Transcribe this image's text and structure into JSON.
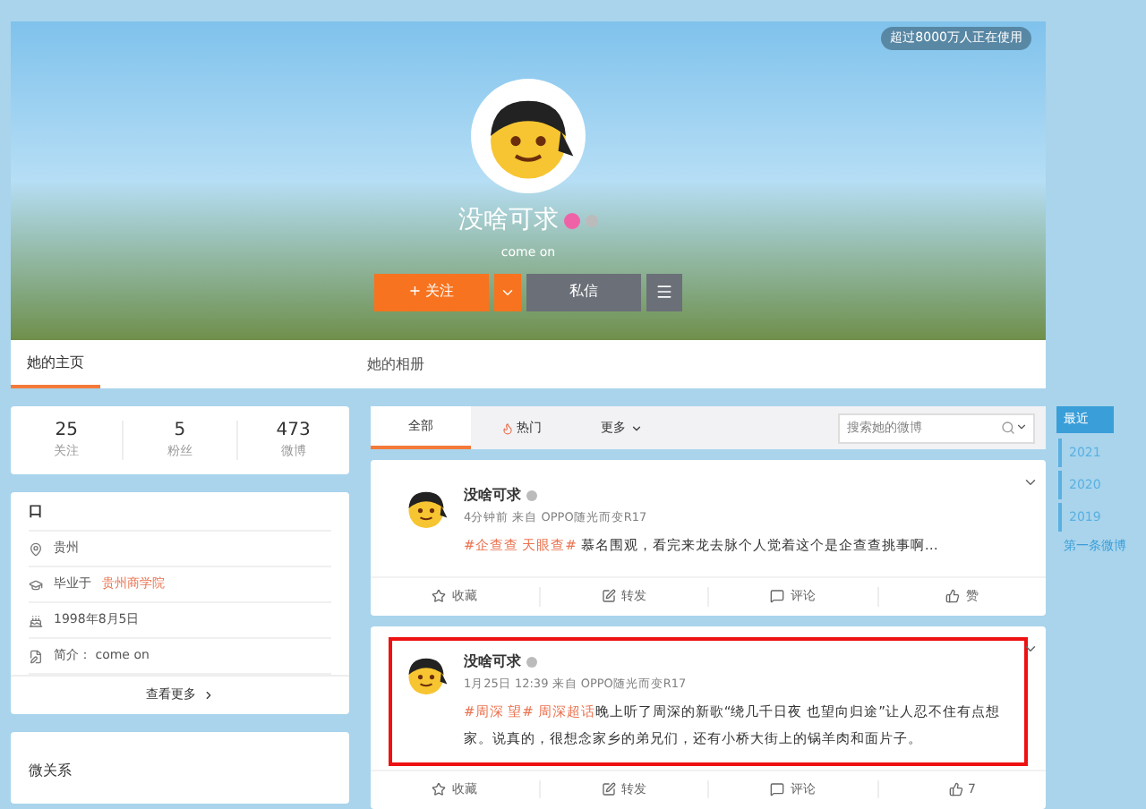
{
  "header": {
    "badge": "超过8000万人正在使用",
    "name": "没啥可求",
    "bio": "come on",
    "follow_button": "+ 关注",
    "message_button": "私信",
    "tabs": [
      {
        "label": "她的主页",
        "selected": true
      },
      {
        "label": "她的相册",
        "selected": false
      }
    ]
  },
  "stats": [
    {
      "value": "25",
      "label": "关注"
    },
    {
      "value": "5",
      "label": "粉丝"
    },
    {
      "value": "473",
      "label": "微博"
    }
  ],
  "info": {
    "title": "口",
    "rows": [
      {
        "kind": "location",
        "text": "贵州"
      },
      {
        "kind": "school",
        "prefix": "毕业于",
        "link": "贵州商学院"
      },
      {
        "kind": "birthday",
        "text": "1998年8月5日"
      },
      {
        "kind": "intro",
        "text": "简介： come on"
      }
    ],
    "more": "查看更多"
  },
  "relations": {
    "title": "微关系"
  },
  "feed_tabs": [
    {
      "label": "全部",
      "selected": true,
      "kind": "plain"
    },
    {
      "label": "热门",
      "selected": false,
      "kind": "hot"
    },
    {
      "label": "更多",
      "selected": false,
      "kind": "more"
    }
  ],
  "search": {
    "placeholder": "搜索她的微博"
  },
  "posts": [
    {
      "name": "没啥可求",
      "meta": "4分钟前 来自 OPPO随光而变R17",
      "highlighted": false,
      "content": [
        {
          "kind": "tag",
          "text": "#企查查 天眼查#"
        },
        {
          "kind": "plain",
          "text": " 慕名围观，看完来龙去脉个人觉着这个是企查查挑事啊…"
        }
      ],
      "actions": [
        {
          "kind": "star",
          "label": "收藏"
        },
        {
          "kind": "repost",
          "label": "转发"
        },
        {
          "kind": "comment",
          "label": "评论"
        },
        {
          "kind": "like",
          "label": "赞"
        }
      ]
    },
    {
      "name": "没啥可求",
      "meta": "1月25日 12:39 来自 OPPO随光而变R17",
      "highlighted": true,
      "content": [
        {
          "kind": "tag",
          "text": "#周深 望#"
        },
        {
          "kind": "topic",
          "text": " 周深超话"
        },
        {
          "kind": "plain",
          "text": "晚上听了周深的新歌“绕几千日夜 也望向归途”让人忍不住有点想家。说真的，很想念家乡的弟兄们，还有小桥大街上的锅羊肉和面片子。"
        }
      ],
      "actions": [
        {
          "kind": "star",
          "label": "收藏"
        },
        {
          "kind": "repost",
          "label": "转发"
        },
        {
          "kind": "comment",
          "label": "评论"
        },
        {
          "kind": "like",
          "label": "7"
        }
      ]
    }
  ],
  "timeline": [
    {
      "label": "最近",
      "selected": true
    },
    {
      "label": "2021",
      "selected": false
    },
    {
      "label": "2020",
      "selected": false
    },
    {
      "label": "2019",
      "selected": false
    },
    {
      "label": "第一条微博",
      "selected": false
    }
  ]
}
